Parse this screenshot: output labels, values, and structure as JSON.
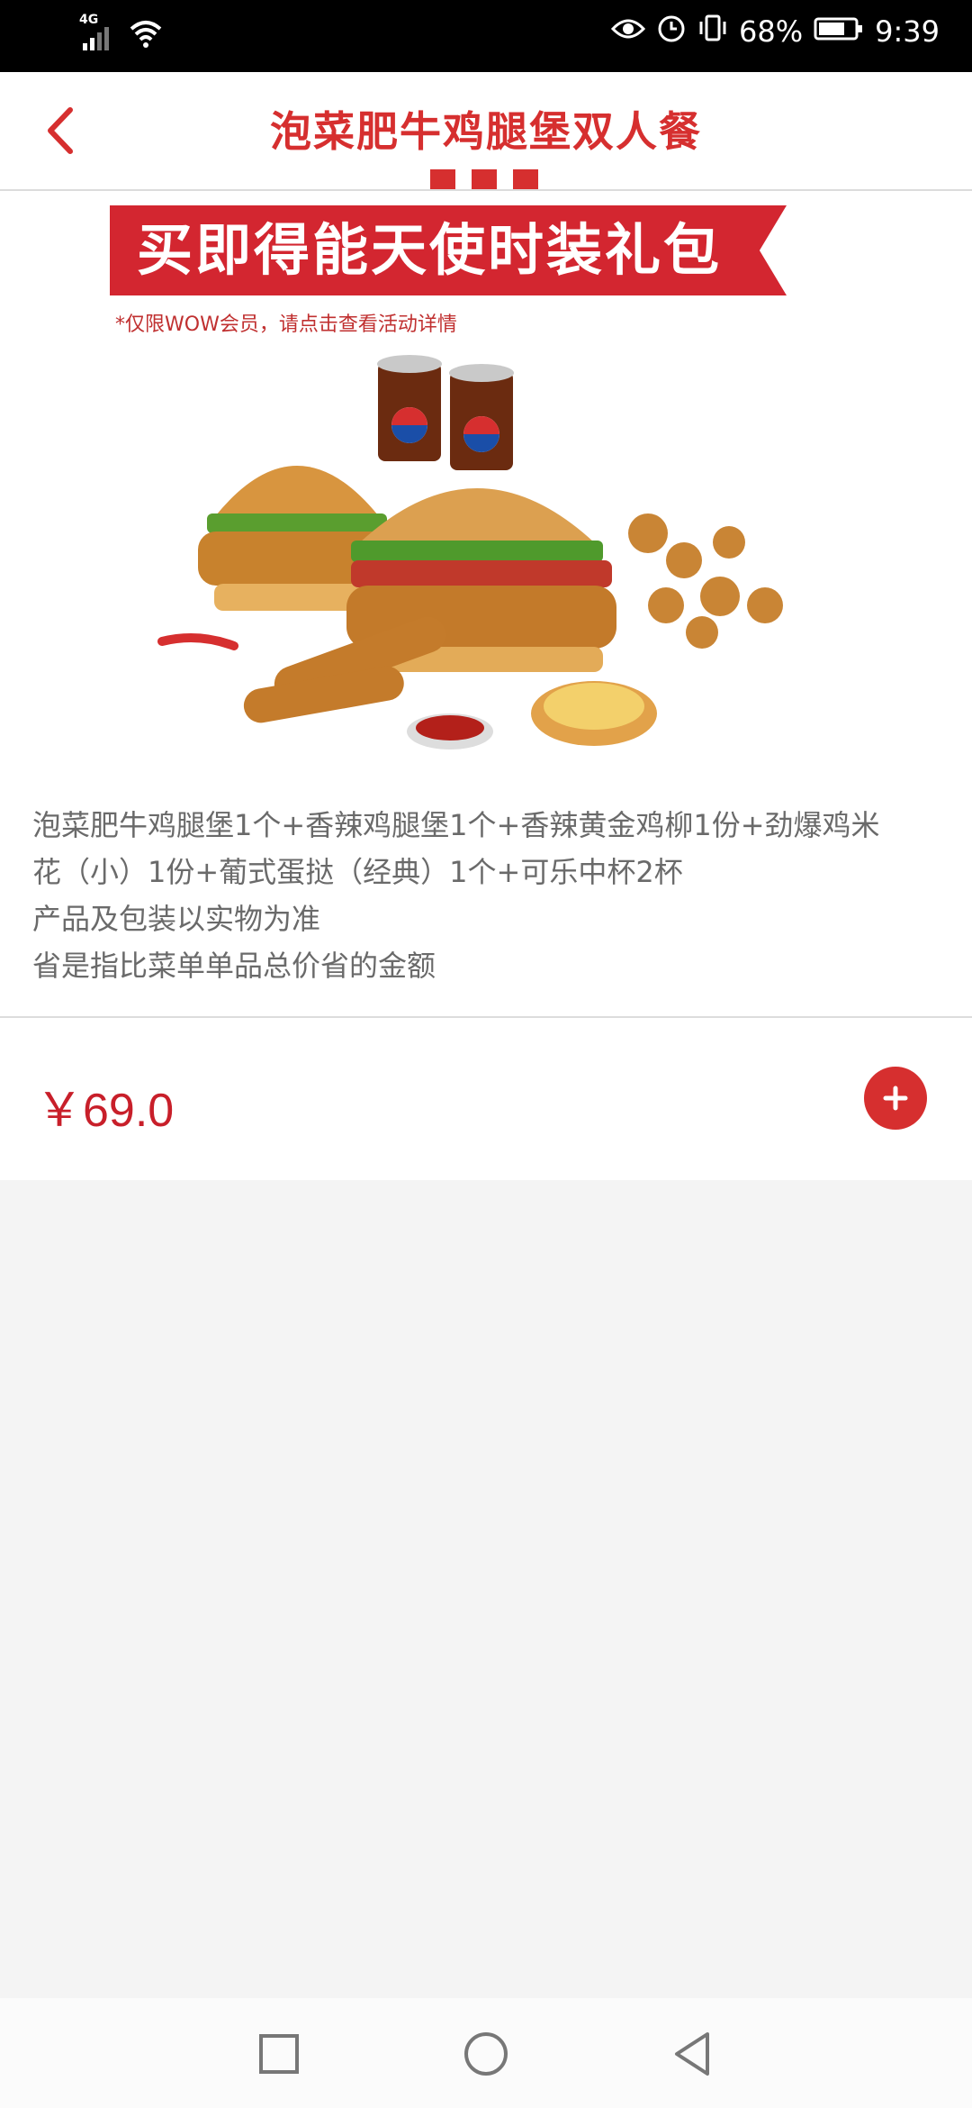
{
  "status_bar": {
    "network": "4G",
    "battery": "68%",
    "time": "9:39"
  },
  "header": {
    "back_icon": "chevron-left-icon",
    "title": "泡菜肥牛鸡腿堡双人餐"
  },
  "promo": {
    "banner_text": "买即得能天使时装礼包",
    "fine_print": "*仅限WOW会员，请点击查看活动详情"
  },
  "product": {
    "description_lines": [
      "泡菜肥牛鸡腿堡1个+香辣鸡腿堡1个+香辣黄金鸡柳1份+劲爆鸡米",
      "花（小）1份+葡式蛋挞（经典）1个+可乐中杯2杯",
      "产品及包装以实物为准",
      "省是指比菜单单品总价省的金额"
    ],
    "price": "￥69.0",
    "add_icon": "plus-icon"
  },
  "colors": {
    "accent": "#d62f2f",
    "price": "#c81f2a",
    "text_secondary": "#6a6a6a",
    "page_bg": "#f4f4f4"
  }
}
